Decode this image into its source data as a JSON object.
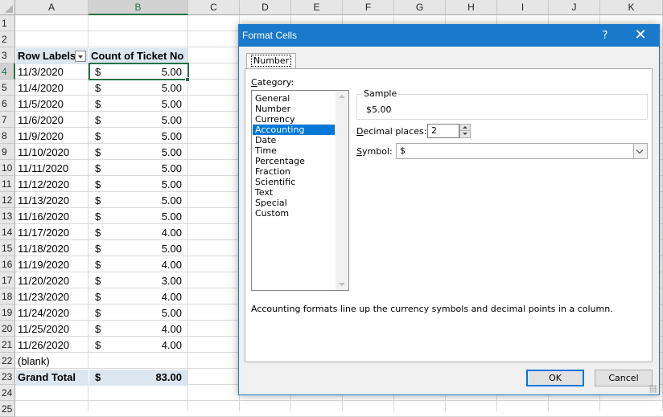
{
  "sheet": {
    "columns": [
      "A",
      "B",
      "C",
      "D",
      "E",
      "F",
      "G",
      "H",
      "I",
      "J",
      "K"
    ],
    "rows": [
      "1",
      "2",
      "3",
      "4",
      "5",
      "6",
      "7",
      "8",
      "9",
      "10",
      "11",
      "12",
      "13",
      "14",
      "15",
      "16",
      "17",
      "18",
      "19",
      "20",
      "21",
      "22",
      "23",
      "24",
      "25"
    ],
    "pivot_header": {
      "row_labels": "Row Labels",
      "count_label": "Count of Ticket No"
    },
    "pivot_rows": [
      {
        "label": "11/3/2020",
        "symbol": "$",
        "value": "5.00"
      },
      {
        "label": "11/4/2020",
        "symbol": "$",
        "value": "5.00"
      },
      {
        "label": "11/5/2020",
        "symbol": "$",
        "value": "5.00"
      },
      {
        "label": "11/6/2020",
        "symbol": "$",
        "value": "5.00"
      },
      {
        "label": "11/9/2020",
        "symbol": "$",
        "value": "5.00"
      },
      {
        "label": "11/10/2020",
        "symbol": "$",
        "value": "5.00"
      },
      {
        "label": "11/11/2020",
        "symbol": "$",
        "value": "5.00"
      },
      {
        "label": "11/12/2020",
        "symbol": "$",
        "value": "5.00"
      },
      {
        "label": "11/13/2020",
        "symbol": "$",
        "value": "5.00"
      },
      {
        "label": "11/16/2020",
        "symbol": "$",
        "value": "5.00"
      },
      {
        "label": "11/17/2020",
        "symbol": "$",
        "value": "4.00"
      },
      {
        "label": "11/18/2020",
        "symbol": "$",
        "value": "5.00"
      },
      {
        "label": "11/19/2020",
        "symbol": "$",
        "value": "4.00"
      },
      {
        "label": "11/20/2020",
        "symbol": "$",
        "value": "3.00"
      },
      {
        "label": "11/23/2020",
        "symbol": "$",
        "value": "4.00"
      },
      {
        "label": "11/24/2020",
        "symbol": "$",
        "value": "5.00"
      },
      {
        "label": "11/25/2020",
        "symbol": "$",
        "value": "4.00"
      },
      {
        "label": "11/26/2020",
        "symbol": "$",
        "value": "4.00"
      },
      {
        "label": "(blank)",
        "symbol": "",
        "value": ""
      }
    ],
    "grand_total": {
      "label": "Grand Total",
      "symbol": "$",
      "value": "83.00"
    },
    "colors": {
      "header_fill": "#dce6f1",
      "selection": "#217346"
    }
  },
  "dialog": {
    "title": "Format Cells",
    "help_glyph": "?",
    "close_glyph": "✕",
    "tab_label": "Number",
    "category_label": "Category:",
    "categories": [
      "General",
      "Number",
      "Currency",
      "Accounting",
      "Date",
      "Time",
      "Percentage",
      "Fraction",
      "Scientific",
      "Text",
      "Special",
      "Custom"
    ],
    "selected_category": "Accounting",
    "sample_label": "Sample",
    "sample_value": "$5.00",
    "decimal_label": "Decimal places:",
    "decimal_value": "2",
    "symbol_label": "Symbol:",
    "symbol_value": "$",
    "description": "Accounting formats line up the currency symbols and decimal points in a column.",
    "ok_label": "OK",
    "cancel_label": "Cancel",
    "colors": {
      "title_bar": "#1979ca",
      "list_selection": "#0078d7"
    }
  }
}
